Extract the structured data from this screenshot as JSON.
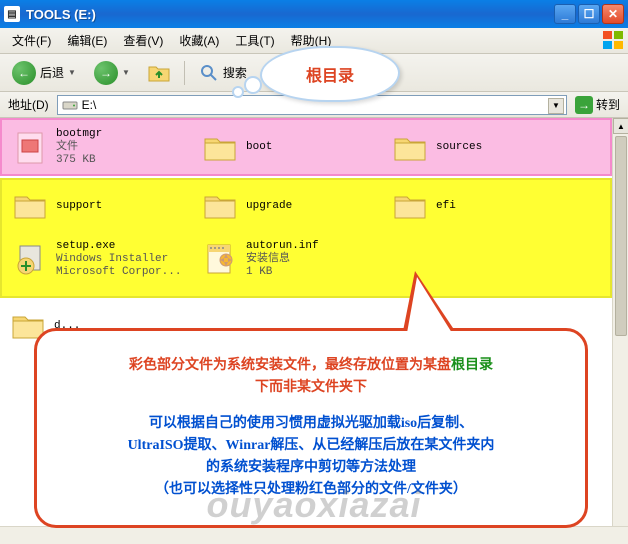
{
  "window": {
    "title": "TOOLS (E:)"
  },
  "menu": {
    "file": "文件(F)",
    "edit": "编辑(E)",
    "view": "查看(V)",
    "favorites": "收藏(A)",
    "tools": "工具(T)",
    "help": "帮助(H)"
  },
  "toolbar": {
    "back": "后退",
    "search": "搜索"
  },
  "address": {
    "label": "地址(D)",
    "value": "E:\\",
    "go": "转到"
  },
  "bubble": {
    "text": "根目录"
  },
  "items": {
    "pink": [
      {
        "name": "bootmgr",
        "meta1": "文件",
        "meta2": "375 KB",
        "icon": "file"
      },
      {
        "name": "boot",
        "icon": "folder"
      },
      {
        "name": "sources",
        "icon": "folder"
      }
    ],
    "yellow": [
      {
        "name": "support",
        "icon": "folder"
      },
      {
        "name": "upgrade",
        "icon": "folder"
      },
      {
        "name": "efi",
        "icon": "folder"
      },
      {
        "name": "setup.exe",
        "meta1": "Windows Installer",
        "meta2": "Microsoft Corpor...",
        "icon": "installer"
      },
      {
        "name": "autorun.inf",
        "meta1": "安装信息",
        "meta2": "1 KB",
        "icon": "inf"
      }
    ],
    "white": [
      {
        "name": "d...",
        "icon": "folder"
      }
    ]
  },
  "speech": {
    "line1a": "彩色部分文件为系统安装文件，最终存放位置为某盘",
    "line1root": "根目录",
    "line1b": "下而非某文件夹下",
    "line2": "可以根据自己的使用习惯用虚拟光驱加载iso后复制、",
    "line3": "UltraISO提取、Winrar解压、从已经解压后放在某文件夹内",
    "line4": "的系统安装程序中剪切等方法处理",
    "line5": "（也可以选择性只处理粉红色部分的文件/文件夹）"
  },
  "watermark": "ouyaoxiazai",
  "status": {
    "left": "",
    "right": ""
  }
}
